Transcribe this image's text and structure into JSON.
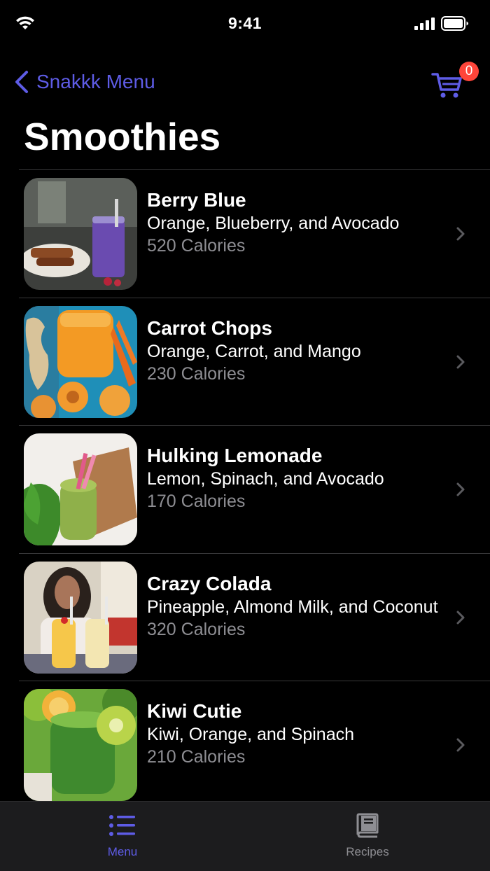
{
  "status_bar": {
    "time": "9:41"
  },
  "nav": {
    "back_label": "Snakkk Menu",
    "cart_count": "0",
    "title": "Smoothies"
  },
  "colors": {
    "accent": "#5e5ce6",
    "badge": "#ff453a",
    "secondary_text": "#8e8e93",
    "background": "#000000"
  },
  "items": [
    {
      "name": "Berry Blue",
      "ingredients": "Orange, Blueberry, and Avocado",
      "calories": "520 Calories"
    },
    {
      "name": "Carrot Chops",
      "ingredients": "Orange, Carrot, and Mango",
      "calories": "230 Calories"
    },
    {
      "name": "Hulking Lemonade",
      "ingredients": "Lemon, Spinach, and Avocado",
      "calories": "170 Calories"
    },
    {
      "name": "Crazy Colada",
      "ingredients": "Pineapple, Almond Milk, and Coconut",
      "calories": "320 Calories"
    },
    {
      "name": "Kiwi Cutie",
      "ingredients": "Kiwi, Orange, and Spinach",
      "calories": "210 Calories"
    }
  ],
  "tabs": [
    {
      "label": "Menu",
      "icon": "list-icon",
      "selected": true
    },
    {
      "label": "Recipes",
      "icon": "book-icon",
      "selected": false
    }
  ]
}
